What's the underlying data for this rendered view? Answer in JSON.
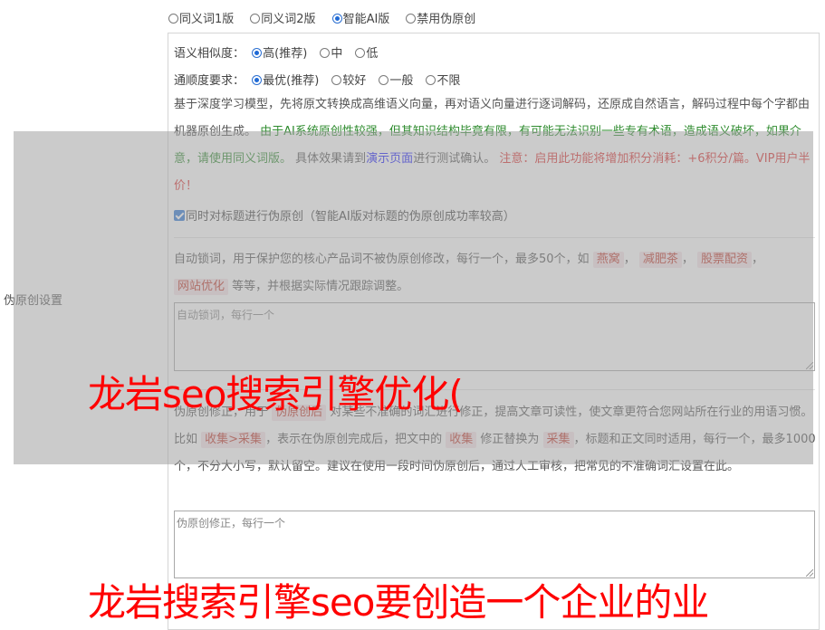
{
  "mode_options": [
    {
      "label": "同义词1版",
      "checked": false
    },
    {
      "label": "同义词2版",
      "checked": false
    },
    {
      "label": "智能AI版",
      "checked": true
    },
    {
      "label": "禁用伪原创",
      "checked": false
    }
  ],
  "similarity": {
    "label": "语义相似度：",
    "options": [
      {
        "label": "高(推荐)",
        "checked": true
      },
      {
        "label": "中",
        "checked": false
      },
      {
        "label": "低",
        "checked": false
      }
    ]
  },
  "fluency": {
    "label": "通顺度要求：",
    "options": [
      {
        "label": "最优(推荐)",
        "checked": true
      },
      {
        "label": "较好",
        "checked": false
      },
      {
        "label": "一般",
        "checked": false
      },
      {
        "label": "不限",
        "checked": false
      }
    ]
  },
  "description": {
    "part1": "基于深度学习模型，先将原文转换成高维语义向量，再对语义向量进行逐词解码，还原成自然语言，解码过程中每个字都由机器原创生成。",
    "green": "由于AI系统原创性较强，但其知识结构毕竟有限，有可能无法识别一些专有术语，造成语义破坏，如果介意，请使用同义词版。",
    "part2": "具体效果请到",
    "link": "演示页面",
    "part3": "进行测试确认。",
    "red": "注意：启用此功能将增加积分消耗：+6积分/篇。VIP用户半价！"
  },
  "title_checkbox": {
    "label": "同时对标题进行伪原创（智能AI版对标题的伪原创成功率较高）",
    "checked": true
  },
  "lock_words": {
    "intro": "自动锁词，用于保护您的核心产品词不被伪原创修改，每行一个，最多50个，如",
    "examples": [
      "燕窝",
      "减肥茶",
      "股票配资",
      "网站优化"
    ],
    "outro": "等等，并根据实际情况跟踪调整。",
    "sep": "，",
    "placeholder": "自动锁词，每行一个"
  },
  "correction": {
    "t1": "伪原创修正，用于",
    "chip1": "伪原创后",
    "t2": "对某些不准确的词汇进行修正，提高文章可读性，使文章更符合您网站所在行业的用语习惯。比如",
    "chip2": "收集>采集",
    "t3": "，表示在伪原创完成后，把文中的",
    "chip3": "收集",
    "t4": "修正替换为",
    "chip4": "采集",
    "t5": "，标题和正文同时适用，每行一个，最多1000个，不分大小写，默认留空。建议在使用一段时间伪原创后，通过人工审核，把常见的不准确词汇设置在此。",
    "placeholder": "伪原创修正，每行一个"
  },
  "side_label": "伪原创设置",
  "watermark1": "龙岩seo搜索引擎优化(",
  "watermark2": "龙岩搜索引擎seo要创造一个企业的业"
}
